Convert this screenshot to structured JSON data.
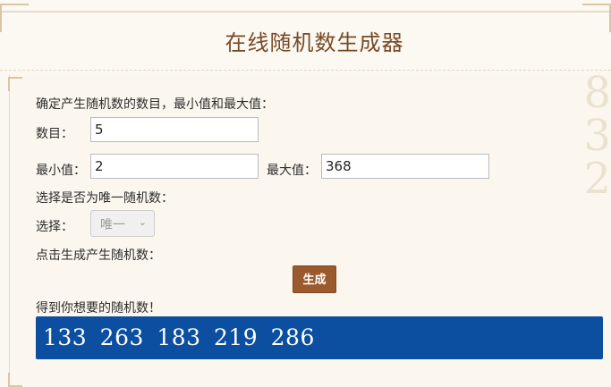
{
  "page": {
    "title": "在线随机数生成器"
  },
  "form": {
    "intro": "确定产生随机数的数目，最小值和最大值：",
    "count_label": "数目：",
    "count_value": "5",
    "min_label": "最小值：",
    "min_value": "2",
    "max_label": "最大值：",
    "max_value": "368",
    "unique_intro": "选择是否为唯一随机数：",
    "select_label": "选择：",
    "select_value": "唯一",
    "click_intro": "点击生成产生随机数：",
    "generate_button": "生成",
    "result_intro": "得到你想要的随机数！"
  },
  "result": {
    "numbers": "133  263  183  219  286"
  },
  "colors": {
    "title": "#7a4a26",
    "button": "#9a5a2e",
    "result_bg": "#0c4ea0"
  }
}
